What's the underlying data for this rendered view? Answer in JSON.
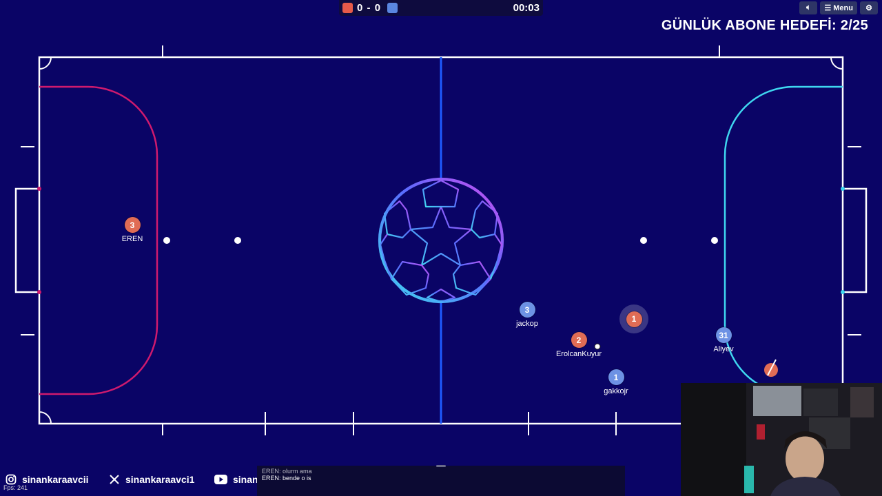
{
  "scoreboard": {
    "red_score": "0",
    "blue_score": "0",
    "separator": "-",
    "timer": "00:03"
  },
  "top_controls": {
    "sound_icon": "speaker-icon",
    "menu_label": "Menu",
    "settings_icon": "gear-icon"
  },
  "overlay": {
    "goal_text": "GÜNLÜK ABONE HEDEFİ: 2/25"
  },
  "players": [
    {
      "number": "3",
      "name": "EREN",
      "team": "red"
    },
    {
      "number": "3",
      "name": "jackop",
      "team": "blue"
    },
    {
      "number": "1",
      "name": "",
      "team": "red",
      "is_me": true
    },
    {
      "number": "2",
      "name": "ErolcanKuyur",
      "team": "red"
    },
    {
      "number": "31",
      "name": "Aliyev",
      "team": "blue"
    },
    {
      "number": "1",
      "name": "gakkojr",
      "team": "blue"
    }
  ],
  "colors": {
    "field_bg": "#0a0466",
    "red_team": "#e06c55",
    "blue_team": "#6d92e4",
    "left_box": "#d01a6e",
    "right_box": "#3fd7f0",
    "center_line": "#1e5bff"
  },
  "socials": [
    {
      "icon": "instagram-icon",
      "handle": "sinankaraavcii"
    },
    {
      "icon": "x-icon",
      "handle": "sinankaraavci1"
    },
    {
      "icon": "youtube-icon",
      "handle": "sinankaraavci"
    }
  ],
  "fps": "Fps: 241",
  "chat": {
    "line1": "EREN: olurm ama",
    "line2": "EREN: bende o is"
  }
}
